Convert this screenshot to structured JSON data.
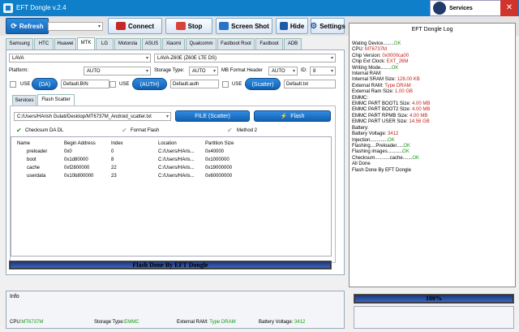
{
  "title": "EFT Dongle  v.2.4",
  "window_controls": {
    "min": "–",
    "max": "□",
    "close": "✕"
  },
  "services": {
    "label": "Services"
  },
  "toolbar": {
    "refresh": "Refresh",
    "connect": "Connect",
    "stop": "Stop",
    "screenshot": "Screen Shot",
    "hide": "Hide",
    "settings": "Settings",
    "port_value": ""
  },
  "tabs": [
    "Samsung",
    "HTC",
    "Huawei",
    "MTK",
    "LG",
    "Motorola",
    "ASUS",
    "Xiaomi",
    "Qualcomm",
    "Fastboot Root",
    "Fastboot",
    "ADB"
  ],
  "active_tab": "MTK",
  "brand_select": "LAVA",
  "model_select": "LAVA-Z60E (Z60E LTE DS)",
  "platform": {
    "label": "Platform:",
    "value": "AUTO"
  },
  "storage": {
    "label": "Storage Type:",
    "value": "AUTO"
  },
  "mb_format": {
    "label": "MB Format Header",
    "value": "AUTO"
  },
  "id_field": {
    "label": "ID:",
    "value": "8"
  },
  "use_label": "USE",
  "da": {
    "pill": "(DA)",
    "file": "Default.BIN"
  },
  "auth": {
    "pill": "(AUTH)",
    "file": "Default.auth"
  },
  "scatter": {
    "pill": "(Scatter)",
    "file": "Default.txt"
  },
  "subtabs": [
    "Services",
    "Flash Scatter"
  ],
  "scatter_path": "C:/Users/HArish Gulati/Desktop/MT6737M_Android_scatter.txt",
  "file_scatter_btn": "FILE (Scatter)",
  "flash_btn": "Flash",
  "checksum_da_dl": "Checksum DA DL",
  "format_flash": "Format  Flash",
  "method2": "Method 2",
  "table": {
    "headers": [
      "Name",
      "Begin Address",
      "Index",
      "Location",
      "Partition Size"
    ],
    "rows": [
      [
        "preloader",
        "0x0",
        "0",
        "C:/Users/HAris...",
        "0x40000"
      ],
      [
        "boot",
        "0x1d80000",
        "8",
        "C:/Users/HAris...",
        "0x1000000"
      ],
      [
        "cache",
        "0xf2800000",
        "22",
        "C:/Users/HAris...",
        "0x19000000"
      ],
      [
        "userdata",
        "0x10b800000",
        "23",
        "C:/Users/HAris...",
        "0x60000000"
      ]
    ]
  },
  "main_progress": {
    "text": "Flash Done By EFT Dongle",
    "fraction": 1.0
  },
  "side_progress": {
    "text": "100%",
    "fraction": 1.0
  },
  "log": {
    "title": "EFT Dongle Log",
    "lines": [
      {
        "k": "Wating Device........",
        "v": "OK",
        "c": "ok"
      },
      {
        "k": "CPU: ",
        "v": "MT6737M",
        "c": "red"
      },
      {
        "k": "Chip Version: ",
        "v": "0x0000ca00",
        "c": "red"
      },
      {
        "k": "Chip Ext Clock: ",
        "v": "EXT_26M",
        "c": "red"
      },
      {
        "k": "Writing Mode........",
        "v": "OK",
        "c": "ok"
      },
      {
        "k": "Internal RAM:",
        "v": "",
        "c": ""
      },
      {
        "k": "Internal SRAM Size: ",
        "v": "128.00 KB",
        "c": "red"
      },
      {
        "k": "External RAM: ",
        "v": "Type DRAM",
        "c": "red"
      },
      {
        "k": "External Ram Size: ",
        "v": "1.00 GB",
        "c": "red"
      },
      {
        "k": "EMMC:",
        "v": "",
        "c": ""
      },
      {
        "k": "EMMC PART BOOT1 Size: ",
        "v": "4.00 MB",
        "c": "red"
      },
      {
        "k": "EMMC PART BOOT2 Size: ",
        "v": "4.00 MB",
        "c": "red"
      },
      {
        "k": "EMMC PART RPMB Size: ",
        "v": "4.00 MB",
        "c": "red"
      },
      {
        "k": "EMMC PART USER Size: ",
        "v": "14.56 GB",
        "c": "red"
      },
      {
        "k": "Battery:",
        "v": "",
        "c": ""
      },
      {
        "k": "Battery Voltage: ",
        "v": "3412",
        "c": "red"
      },
      {
        "k": "Injection.............",
        "v": "OK",
        "c": "ok"
      },
      {
        "k": "Flashing....Preloader.....",
        "v": "OK",
        "c": "ok"
      },
      {
        "k": "Flashing images...........",
        "v": "OK",
        "c": "ok"
      },
      {
        "k": "Checksum...........cache.......",
        "v": "OK",
        "c": "ok"
      },
      {
        "k": "All Done",
        "v": "",
        "c": ""
      },
      {
        "k": "Flash Done By EFT Dongle",
        "v": "",
        "c": ""
      }
    ]
  },
  "info": {
    "title": "Info",
    "cpu_label": "CPU:",
    "cpu": "MT6737M",
    "storage_label": "Storage Type:",
    "storage": "EMMC",
    "ext_ram_label": "External RAM:",
    "ext_ram": "Type DRAM",
    "battery_label": "Battery Voltage:",
    "battery": "3412"
  },
  "colors": {
    "accent": "#0f7fc9",
    "ok": "#1a9a1a",
    "error": "#c0201a"
  }
}
